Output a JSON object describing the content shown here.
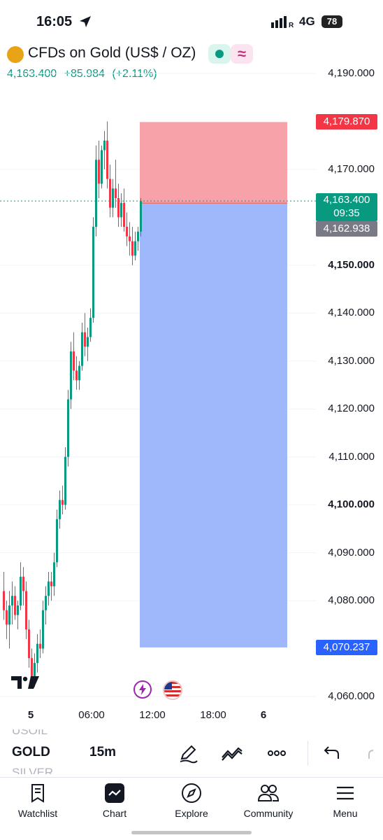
{
  "status_bar": {
    "time": "16:05",
    "network": "4G",
    "battery": "78"
  },
  "header": {
    "symbol_title": "CFDs on Gold (US$ / OZ)",
    "last_price": "4,163.400",
    "change": "+85.984",
    "change_pct": "(+2.11%)",
    "market_status": "open",
    "pattern_icon": "≈"
  },
  "price_scale": {
    "ticks": [
      {
        "label": "4,190.000",
        "value": 4190,
        "bold": false
      },
      {
        "label": "4,170.000",
        "value": 4170,
        "bold": false
      },
      {
        "label": "4,150.000",
        "value": 4150,
        "bold": true
      },
      {
        "label": "4,140.000",
        "value": 4140,
        "bold": false
      },
      {
        "label": "4,130.000",
        "value": 4130,
        "bold": false
      },
      {
        "label": "4,120.000",
        "value": 4120,
        "bold": false
      },
      {
        "label": "4,110.000",
        "value": 4110,
        "bold": false
      },
      {
        "label": "4,100.000",
        "value": 4100,
        "bold": true
      },
      {
        "label": "4,090.000",
        "value": 4090,
        "bold": false
      },
      {
        "label": "4,080.000",
        "value": 4080,
        "bold": false
      },
      {
        "label": "4,060.000",
        "value": 4060,
        "bold": false
      }
    ],
    "stop_label": "4,179.870",
    "last_label": "4,163.400",
    "countdown": "09:35",
    "entry_label": "4,162.938",
    "target_label": "4,070.237",
    "colors": {
      "up": "#089981",
      "down": "#f23645",
      "stop": "#f23645",
      "target": "#2962ff",
      "entry": "#787b86"
    }
  },
  "time_axis": {
    "labels": [
      {
        "label": "5",
        "bold": true
      },
      {
        "label": "06:00",
        "bold": false
      },
      {
        "label": "12:00",
        "bold": false
      },
      {
        "label": "18:00",
        "bold": false
      },
      {
        "label": "6",
        "bold": true
      }
    ]
  },
  "chart_data": {
    "type": "candlestick",
    "symbol": "CFDs on Gold (US$ / OZ)",
    "interval": "15m",
    "ylim": [
      4055,
      4200
    ],
    "position": {
      "type": "long",
      "entry": 4162.938,
      "stop": 4179.87,
      "target": 4070.237
    },
    "candles": [
      [
        4082,
        4086,
        4076,
        4078
      ],
      [
        4078,
        4080,
        4072,
        4075
      ],
      [
        4075,
        4082,
        4070,
        4079
      ],
      [
        4079,
        4084,
        4075,
        4081
      ],
      [
        4081,
        4083,
        4076,
        4077
      ],
      [
        4077,
        4080,
        4074,
        4079
      ],
      [
        4079,
        4088,
        4078,
        4085
      ],
      [
        4085,
        4087,
        4079,
        4082
      ],
      [
        4082,
        4084,
        4072,
        4074
      ],
      [
        4074,
        4076,
        4066,
        4068
      ],
      [
        4068,
        4070,
        4062,
        4064
      ],
      [
        4064,
        4069,
        4062,
        4067
      ],
      [
        4067,
        4073,
        4065,
        4071
      ],
      [
        4071,
        4074,
        4068,
        4070
      ],
      [
        4070,
        4080,
        4069,
        4078
      ],
      [
        4078,
        4083,
        4075,
        4081
      ],
      [
        4081,
        4086,
        4079,
        4084
      ],
      [
        4084,
        4086,
        4080,
        4083
      ],
      [
        4083,
        4090,
        4081,
        4088
      ],
      [
        4088,
        4099,
        4087,
        4097
      ],
      [
        4097,
        4103,
        4095,
        4101
      ],
      [
        4101,
        4104,
        4098,
        4100
      ],
      [
        4100,
        4112,
        4099,
        4110
      ],
      [
        4110,
        4124,
        4108,
        4122
      ],
      [
        4122,
        4134,
        4120,
        4132
      ],
      [
        4132,
        4136,
        4126,
        4128
      ],
      [
        4128,
        4131,
        4124,
        4126
      ],
      [
        4126,
        4130,
        4124,
        4129
      ],
      [
        4129,
        4138,
        4128,
        4136
      ],
      [
        4136,
        4140,
        4131,
        4133
      ],
      [
        4133,
        4137,
        4130,
        4135
      ],
      [
        4135,
        4141,
        4134,
        4139
      ],
      [
        4139,
        4160,
        4138,
        4158
      ],
      [
        4158,
        4175,
        4156,
        4172
      ],
      [
        4172,
        4176,
        4164,
        4167
      ],
      [
        4167,
        4175,
        4166,
        4174
      ],
      [
        4174,
        4178,
        4170,
        4176
      ],
      [
        4176,
        4180,
        4166,
        4168
      ],
      [
        4168,
        4171,
        4160,
        4162
      ],
      [
        4162,
        4168,
        4160,
        4166
      ],
      [
        4166,
        4172,
        4162,
        4164
      ],
      [
        4164,
        4167,
        4158,
        4160
      ],
      [
        4160,
        4165,
        4158,
        4163
      ],
      [
        4163,
        4166,
        4157,
        4158
      ],
      [
        4158,
        4161,
        4154,
        4156
      ],
      [
        4156,
        4159,
        4152,
        4155
      ],
      [
        4155,
        4158,
        4150,
        4152
      ],
      [
        4152,
        4157,
        4151,
        4155
      ],
      [
        4155,
        4158,
        4153,
        4157
      ],
      [
        4157,
        4164,
        4156,
        4163.4
      ]
    ]
  },
  "toolbar": {
    "current_symbol": "GOLD",
    "prev_symbol": "USOIL",
    "next_symbol": "SILVER",
    "interval": "15m"
  },
  "nav": {
    "items": [
      {
        "label": "Watchlist"
      },
      {
        "label": "Chart"
      },
      {
        "label": "Explore"
      },
      {
        "label": "Community"
      },
      {
        "label": "Menu"
      }
    ]
  }
}
